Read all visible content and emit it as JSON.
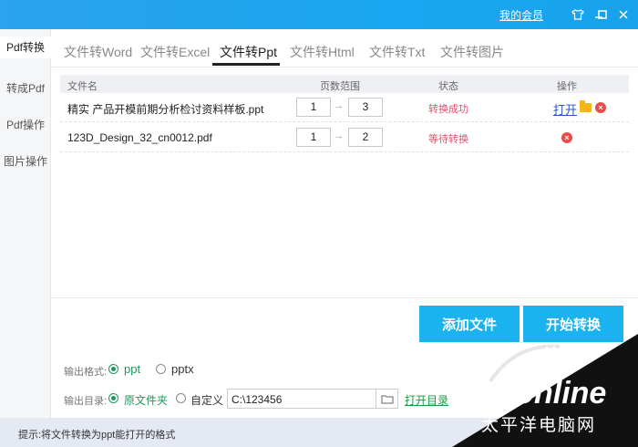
{
  "titlebar": {
    "member_label": "我的会员",
    "icons": [
      "shirt-icon",
      "minimize-icon",
      "maximize-icon",
      "close-icon"
    ]
  },
  "sidebar": {
    "items": [
      {
        "label": "Pdf转换",
        "active": true
      },
      {
        "label": "转成Pdf",
        "active": false
      },
      {
        "label": "Pdf操作",
        "active": false
      },
      {
        "label": "图片操作",
        "active": false
      }
    ]
  },
  "tabs": [
    {
      "label": "文件转Word",
      "active": false
    },
    {
      "label": "文件转Excel",
      "active": false
    },
    {
      "label": "文件转Ppt",
      "active": true
    },
    {
      "label": "文件转Html",
      "active": false
    },
    {
      "label": "文件转Txt",
      "active": false
    },
    {
      "label": "文件转图片",
      "active": false
    }
  ],
  "table": {
    "headers": {
      "name": "文件名",
      "range": "页数范围",
      "status": "状态",
      "action": "操作"
    },
    "rows": [
      {
        "name": "精实  产品开模前期分析检讨资料样板.ppt",
        "from": "1",
        "to": "3",
        "status": "转换成功",
        "open_label": "打开"
      },
      {
        "name": "123D_Design_32_cn0012.pdf",
        "from": "1",
        "to": "2",
        "status": "等待转换"
      }
    ]
  },
  "buttons": {
    "add_files": "添加文件",
    "start": "开始转换"
  },
  "output": {
    "format_label": "输出格式:",
    "format_options": [
      "ppt",
      "pptx"
    ],
    "format_selected": "ppt",
    "dir_label": "输出目录:",
    "dir_options": [
      "原文件夹",
      "自定义"
    ],
    "dir_selected": "原文件夹",
    "path_value": "C:\\123456",
    "open_dir_label": "打开目录"
  },
  "statusbar": {
    "text": "提示:将文件转换为ppt能打开的格式"
  },
  "watermark": {
    "brand": "PConline",
    "tagline": "太平洋电脑网"
  },
  "colors": {
    "titlebar": "#1aa6f0",
    "primary_button": "#1ab2ef",
    "success": "#e74c6c",
    "pending": "#e74c6c",
    "radio_on": "#1a9a5a",
    "open_dir": "#1a9a3a"
  }
}
